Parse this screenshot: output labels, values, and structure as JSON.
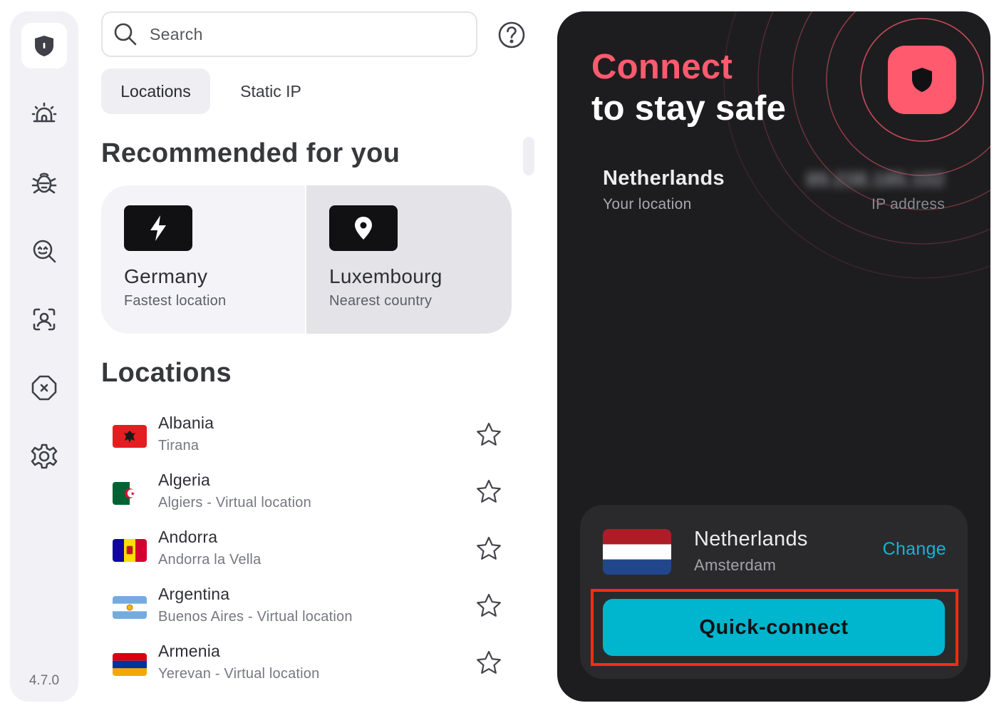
{
  "sidebar": {
    "items": [
      {
        "icon": "shield-icon",
        "active": true
      },
      {
        "icon": "alarm-icon",
        "active": false
      },
      {
        "icon": "bug-icon",
        "active": false
      },
      {
        "icon": "search-face-icon",
        "active": false
      },
      {
        "icon": "face-scan-icon",
        "active": false
      },
      {
        "icon": "block-icon",
        "active": false
      },
      {
        "icon": "gear-icon",
        "active": false
      }
    ],
    "version": "4.7.0"
  },
  "search": {
    "placeholder": "Search",
    "value": ""
  },
  "help_icon": "question-circle-icon",
  "tabs": [
    {
      "label": "Locations",
      "active": true
    },
    {
      "label": "Static IP",
      "active": false
    }
  ],
  "recommended": {
    "heading": "Recommended for you",
    "cards": [
      {
        "icon": "lightning-icon",
        "title": "Germany",
        "subtitle": "Fastest location"
      },
      {
        "icon": "location-pin-icon",
        "title": "Luxembourg",
        "subtitle": "Nearest country"
      }
    ]
  },
  "locations": {
    "heading": "Locations",
    "items": [
      {
        "country": "Albania",
        "city": "Tirana",
        "flag": "albania"
      },
      {
        "country": "Algeria",
        "city": "Algiers - Virtual location",
        "flag": "algeria"
      },
      {
        "country": "Andorra",
        "city": "Andorra la Vella",
        "flag": "andorra"
      },
      {
        "country": "Argentina",
        "city": "Buenos Aires - Virtual location",
        "flag": "argentina"
      },
      {
        "country": "Armenia",
        "city": "Yerevan - Virtual location",
        "flag": "armenia"
      }
    ]
  },
  "panel": {
    "headline_accent": "Connect",
    "headline_main": "to stay safe",
    "current_country": "Netherlands",
    "current_label": "Your location",
    "ip_value": "89.238.185.102",
    "ip_label": "IP address",
    "connection": {
      "country": "Netherlands",
      "city": "Amsterdam",
      "change_label": "Change",
      "quick_connect_label": "Quick-connect"
    }
  },
  "colors": {
    "accent_red": "#ff5a6e",
    "accent_cyan": "#00b5ce",
    "panel_bg": "#1d1d1f",
    "highlight_border": "#ff2a10"
  }
}
